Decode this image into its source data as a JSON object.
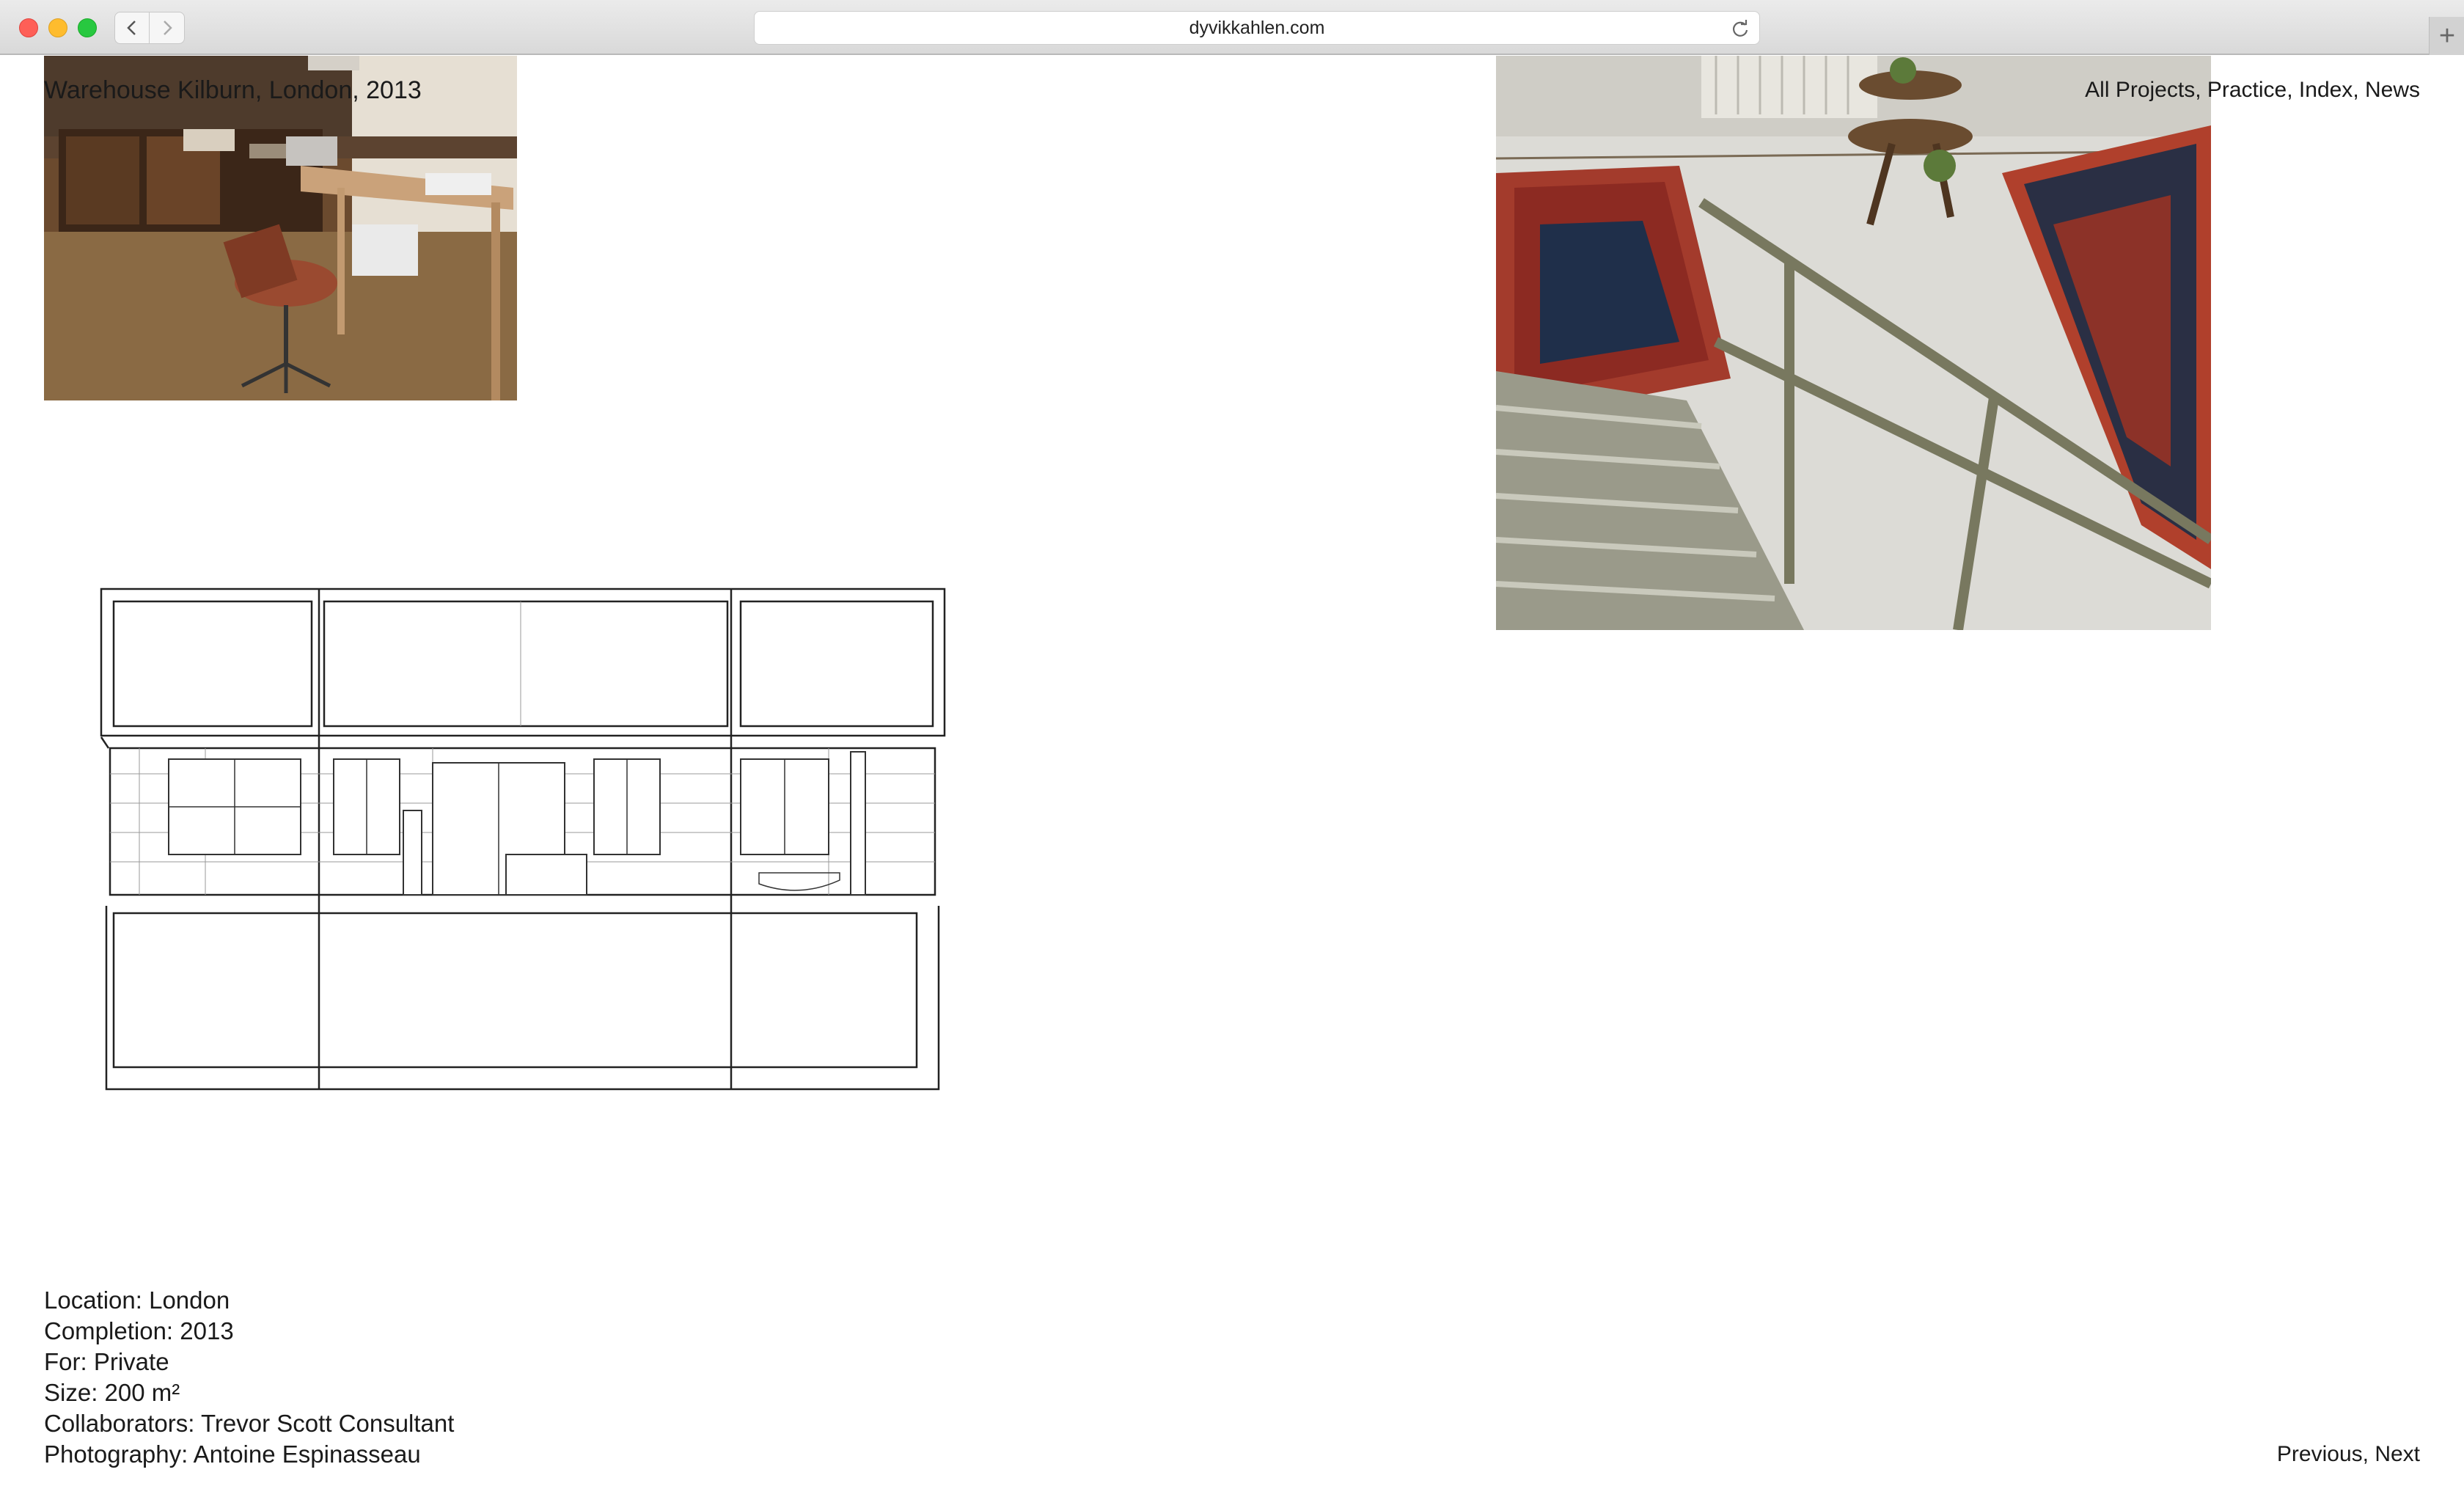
{
  "browser": {
    "url": "dyvikkahlen.com",
    "new_tab_label": "+"
  },
  "project": {
    "title": "Warehouse Kilburn, London, 2013"
  },
  "nav": {
    "items": [
      {
        "label": "All Projects",
        "sep": ", "
      },
      {
        "label": "Practice",
        "sep": ", "
      },
      {
        "label": "Index",
        "sep": ", "
      },
      {
        "label": "News",
        "sep": ""
      }
    ]
  },
  "info": {
    "location": "Location: London",
    "completion": "Completion: 2013",
    "client": "For: Private",
    "size": "Size: 200 m²",
    "collaborators": "Collaborators: Trevor Scott Consultant",
    "photography": "Photography: Antoine Espinasseau"
  },
  "pager": {
    "previous": "Previous",
    "sep": ", ",
    "next": "Next"
  }
}
